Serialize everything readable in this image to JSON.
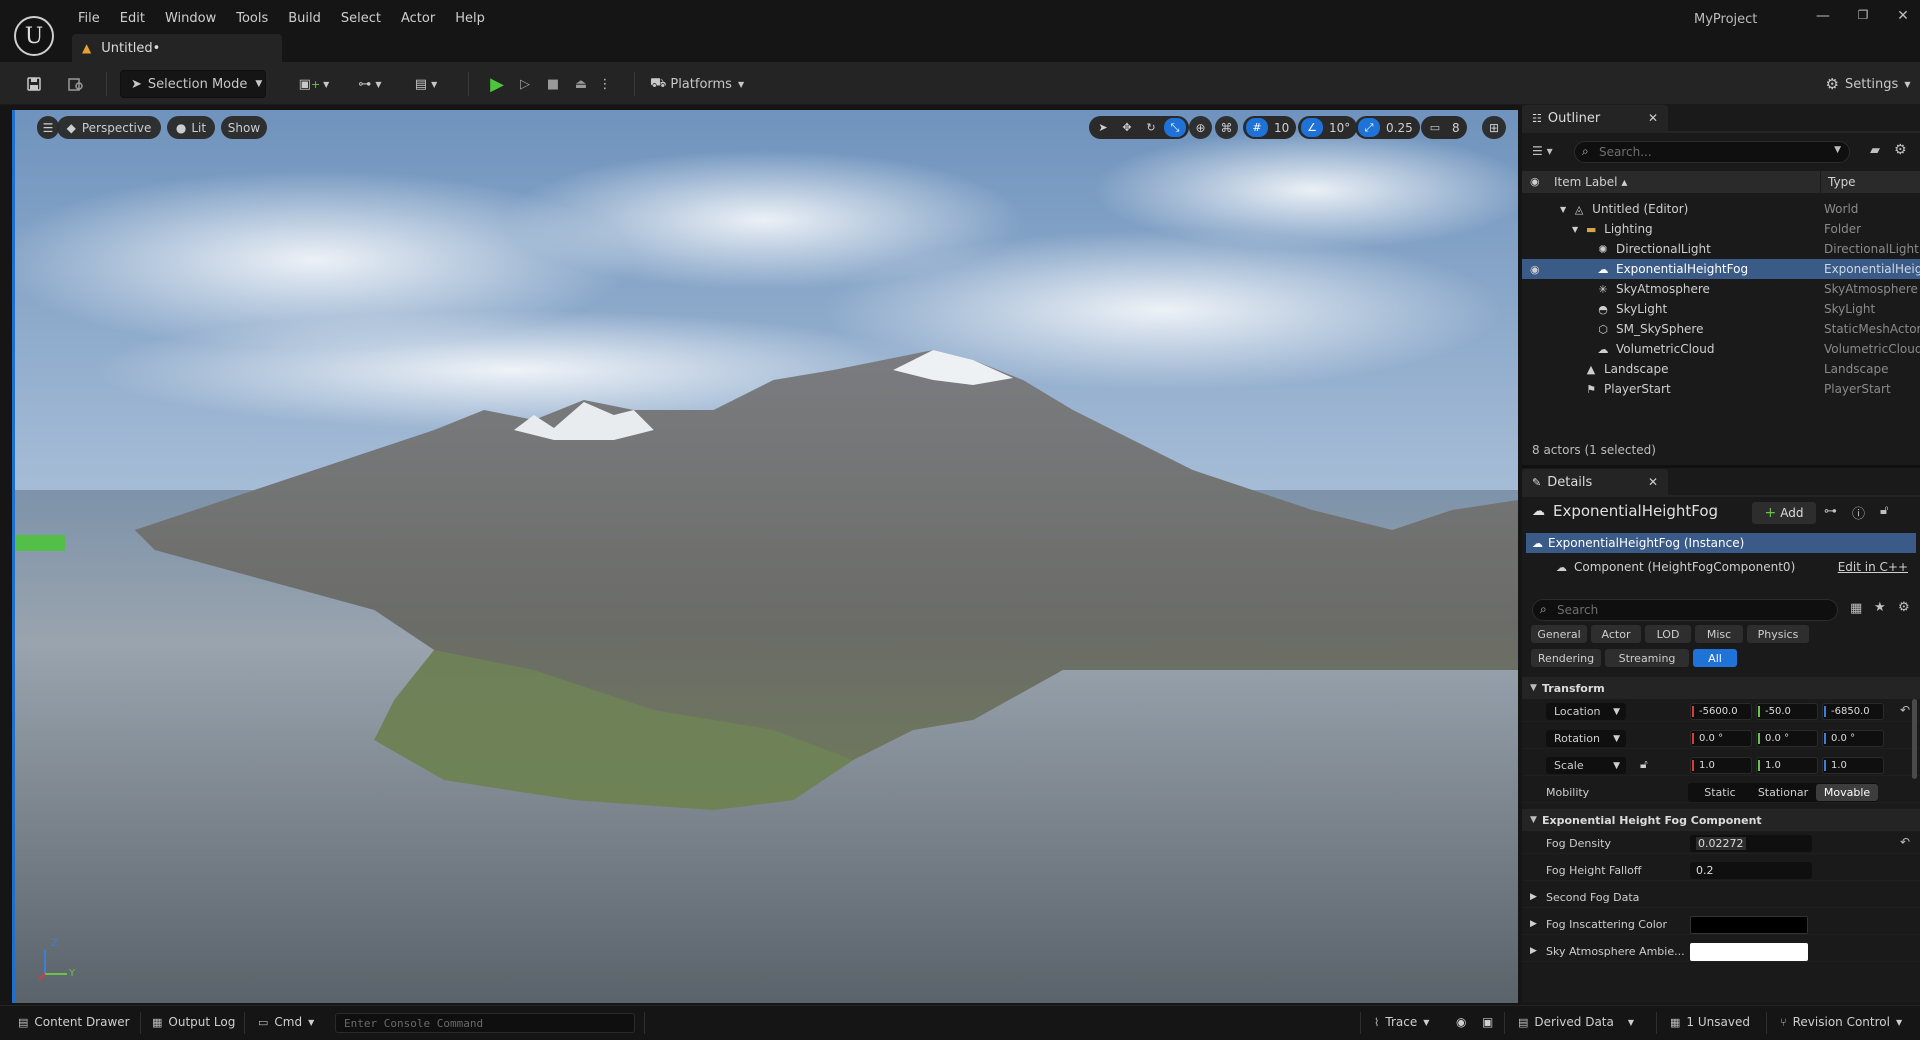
{
  "app": {
    "project_name": "MyProject",
    "doc_tab": "Untitled•",
    "logo_glyph": "U"
  },
  "menu": [
    "File",
    "Edit",
    "Window",
    "Tools",
    "Build",
    "Select",
    "Actor",
    "Help"
  ],
  "toolbar": {
    "selection_mode": "Selection Mode",
    "platforms": "Platforms",
    "settings": "Settings"
  },
  "viewport": {
    "perspective": "Perspective",
    "lit": "Lit",
    "show": "Show",
    "grid_snap": "10",
    "rot_snap": "10°",
    "scale_snap": "0.25",
    "cam_speed": "8",
    "axis_z": "Z",
    "axis_y": "Y"
  },
  "outliner": {
    "tab": "Outliner",
    "search_placeholder": "Search...",
    "col_label": "Item Label",
    "col_type": "Type",
    "rows": [
      {
        "label": "Untitled (Editor)",
        "type": "World",
        "icon": "world-icon"
      },
      {
        "label": "Lighting",
        "type": "Folder",
        "icon": "folder-icon"
      },
      {
        "label": "DirectionalLight",
        "type": "DirectionalLight",
        "icon": "sun-icon"
      },
      {
        "label": "ExponentialHeightFog",
        "type": "ExponentialHeightFog",
        "icon": "fog-icon",
        "selected": true
      },
      {
        "label": "SkyAtmosphere",
        "type": "SkyAtmosphere",
        "icon": "atmosphere-icon"
      },
      {
        "label": "SkyLight",
        "type": "SkyLight",
        "icon": "skylight-icon"
      },
      {
        "label": "SM_SkySphere",
        "type": "StaticMeshActor",
        "icon": "mesh-icon"
      },
      {
        "label": "VolumetricCloud",
        "type": "VolumetricCloud",
        "icon": "cloud-icon"
      },
      {
        "label": "Landscape",
        "type": "Landscape",
        "icon": "landscape-icon"
      },
      {
        "label": "PlayerStart",
        "type": "PlayerStart",
        "icon": "player-start-icon"
      }
    ],
    "actor_count": "8 actors (1 selected)"
  },
  "details": {
    "tab": "Details",
    "title": "ExponentialHeightFog",
    "add_label": "Add",
    "instance": "ExponentialHeightFog (Instance)",
    "component": "Component (HeightFogComponent0)",
    "edit_cpp": "Edit in C++",
    "search_placeholder": "Search",
    "filters": [
      "General",
      "Actor",
      "LOD",
      "Misc",
      "Physics",
      "Rendering",
      "Streaming",
      "All"
    ],
    "transform_header": "Transform",
    "location_label": "Location",
    "rotation_label": "Rotation",
    "scale_label": "Scale",
    "location": [
      "-5600.0",
      "-50.0",
      "-6850.0"
    ],
    "rotation": [
      "0.0 °",
      "0.0 °",
      "0.0 °"
    ],
    "scale": [
      "1.0",
      "1.0",
      "1.0"
    ],
    "mobility_label": "Mobility",
    "mobility_options": [
      "Static",
      "Stationar",
      "Movable"
    ],
    "fog_header": "Exponential Height Fog Component",
    "fog_density_label": "Fog Density",
    "fog_density": "0.02272",
    "fog_falloff_label": "Fog Height Falloff",
    "fog_falloff": "0.2",
    "second_fog_label": "Second Fog Data",
    "inscatter_label": "Fog Inscattering Color",
    "sky_ambient_label": "Sky Atmosphere Ambie...",
    "inscatter_color": "#000000",
    "sky_ambient_color": "#ffffff"
  },
  "statusbar": {
    "content_drawer": "Content Drawer",
    "output_log": "Output Log",
    "cmd": "Cmd",
    "console_placeholder": "Enter Console Command",
    "trace": "Trace",
    "derived_data": "Derived Data",
    "unsaved": "1 Unsaved",
    "revision_control": "Revision Control"
  },
  "colors": {
    "accent": "#1e72d8",
    "selection": "#3a5a87",
    "play": "#4ec33d"
  }
}
